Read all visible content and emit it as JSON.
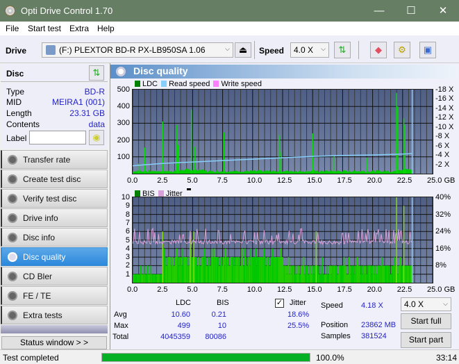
{
  "window": {
    "title": "Opti Drive Control 1.70",
    "minimize": "—",
    "maximize": "☐",
    "close": "✕"
  },
  "menu": [
    "File",
    "Start test",
    "Extra",
    "Help"
  ],
  "toolbar": {
    "drive_label": "Drive",
    "drive_value": "(F:)  PLEXTOR BD-R  PX-LB950SA 1.06",
    "speed_label": "Speed",
    "speed_value": "4.0 X",
    "eject": "⏏",
    "chev": "⌵"
  },
  "disc": {
    "header": "Disc",
    "rows": [
      {
        "k": "Type",
        "v": "BD-R"
      },
      {
        "k": "MID",
        "v": "MEIRA1 (001)"
      },
      {
        "k": "Length",
        "v": "23.31 GB"
      },
      {
        "k": "Contents",
        "v": "data"
      }
    ],
    "label_label": "Label",
    "label_value": ""
  },
  "nav": [
    {
      "label": "Transfer rate"
    },
    {
      "label": "Create test disc"
    },
    {
      "label": "Verify test disc"
    },
    {
      "label": "Drive info"
    },
    {
      "label": "Disc info"
    },
    {
      "label": "Disc quality",
      "active": true
    },
    {
      "label": "CD Bler"
    },
    {
      "label": "FE / TE"
    },
    {
      "label": "Extra tests"
    }
  ],
  "status_window": "Status window > >",
  "panel": {
    "title": "Disc quality"
  },
  "chart_data": [
    {
      "type": "bar",
      "title": "LDC / Read speed",
      "legend": [
        {
          "name": "LDC",
          "color": "#008000"
        },
        {
          "name": "Read speed",
          "color": "#87cefa"
        },
        {
          "name": "Write speed",
          "color": "#ff80ff"
        }
      ],
      "xlabel": "GB",
      "xlim": [
        0,
        25
      ],
      "xticks": [
        "0.0",
        "2.5",
        "5.0",
        "7.5",
        "10.0",
        "12.5",
        "15.0",
        "17.5",
        "20.0",
        "22.5",
        "25.0 GB"
      ],
      "ylim": [
        0,
        500
      ],
      "yticks": [
        "500",
        "400",
        "300",
        "200",
        "100"
      ],
      "y2lim": [
        0,
        18
      ],
      "y2ticks": [
        "18 X",
        "16 X",
        "14 X",
        "12 X",
        "10 X",
        "8 X",
        "6 X",
        "4 X",
        "2 X"
      ],
      "spikes": [
        [
          0.5,
          60
        ],
        [
          1.0,
          155
        ],
        [
          2.5,
          310
        ],
        [
          3.7,
          290
        ],
        [
          3.8,
          170
        ],
        [
          4.9,
          380
        ],
        [
          5.2,
          160
        ],
        [
          7.6,
          245
        ],
        [
          12.2,
          230
        ],
        [
          12.4,
          130
        ],
        [
          15.0,
          240
        ],
        [
          16.8,
          110
        ],
        [
          19.5,
          95
        ],
        [
          22.0,
          480
        ],
        [
          22.1,
          400
        ],
        [
          22.6,
          330
        ],
        [
          22.7,
          290
        ]
      ],
      "read_speed": [
        [
          0,
          1.7
        ],
        [
          1,
          1.9
        ],
        [
          2.5,
          2.2
        ],
        [
          5,
          2.5
        ],
        [
          7.5,
          2.8
        ],
        [
          10,
          3.1
        ],
        [
          12.5,
          3.4
        ],
        [
          15,
          3.7
        ],
        [
          17.5,
          3.9
        ],
        [
          20,
          4.0
        ],
        [
          22.5,
          4.2
        ],
        [
          23.3,
          4.3
        ]
      ],
      "end_marker": 23.3
    },
    {
      "type": "bar",
      "title": "BIS / Jitter",
      "legend": [
        {
          "name": "BIS",
          "color": "#008000"
        },
        {
          "name": "Jitter",
          "color": "#d8a0d8"
        }
      ],
      "xlim": [
        0,
        25
      ],
      "xticks": [
        "0.0",
        "2.5",
        "5.0",
        "7.5",
        "10.0",
        "12.5",
        "15.0",
        "17.5",
        "20.0",
        "22.5",
        "25.0 GB"
      ],
      "ylim": [
        0,
        10
      ],
      "yticks": [
        "10",
        "9",
        "8",
        "7",
        "6",
        "5",
        "4",
        "3",
        "2",
        "1"
      ],
      "y2lim": [
        0,
        40
      ],
      "y2ticks": [
        "40%",
        "32%",
        "24%",
        "16%",
        "8%"
      ],
      "bis_levels": [
        [
          0,
          2.4,
          1
        ],
        [
          2.4,
          12.5,
          3
        ],
        [
          12.5,
          16,
          2
        ],
        [
          16,
          21.5,
          2
        ],
        [
          21.5,
          23.3,
          2
        ]
      ],
      "bis_spikes": [
        [
          2.5,
          6
        ],
        [
          4.8,
          6
        ],
        [
          5.1,
          6
        ],
        [
          22.0,
          10
        ],
        [
          22.6,
          9
        ],
        [
          15.3,
          6
        ]
      ],
      "jitter_avg": 18.6,
      "jitter_max": 25.5,
      "end_marker": 23.3
    }
  ],
  "stats": {
    "cols": [
      "LDC",
      "BIS"
    ],
    "rows": [
      {
        "k": "Avg",
        "ldc": "10.60",
        "bis": "0.21",
        "jit": "18.6%"
      },
      {
        "k": "Max",
        "ldc": "499",
        "bis": "10",
        "jit": "25.5%"
      },
      {
        "k": "Total",
        "ldc": "4045359",
        "bis": "80086",
        "jit": ""
      }
    ],
    "jitter_label": "Jitter",
    "jitter_checked": true,
    "speed_label": "Speed",
    "speed_value": "4.18 X",
    "position_label": "Position",
    "position_value": "23862 MB",
    "samples_label": "Samples",
    "samples_value": "381524",
    "speed_select": "4.0 X",
    "start_full": "Start full",
    "start_part": "Start part"
  },
  "statusbar": {
    "text": "Test completed",
    "progress": 100.0,
    "progress_text": "100.0%",
    "time": "33:14"
  }
}
